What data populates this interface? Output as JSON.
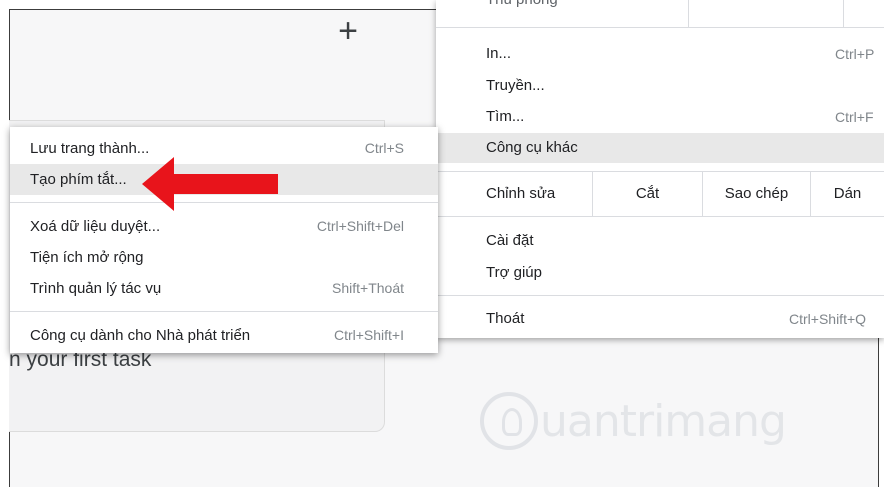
{
  "background": {
    "add_symbol": "+",
    "task_text": "n your first task",
    "watermark": "uantrimang"
  },
  "main_menu": {
    "top_partial_label": "Thu phóng",
    "items": [
      {
        "label": "In...",
        "shortcut": "Ctrl+P"
      },
      {
        "label": "Truyền...",
        "shortcut": ""
      },
      {
        "label": "Tìm...",
        "shortcut": "Ctrl+F"
      },
      {
        "label": "Công cụ khác",
        "shortcut": ""
      }
    ],
    "edit": {
      "label": "Chỉnh sửa",
      "cut": "Cắt",
      "copy": "Sao chép",
      "paste": "Dán"
    },
    "settings": "Cài đặt",
    "help": "Trợ giúp",
    "exit": {
      "label": "Thoát",
      "shortcut": "Ctrl+Shift+Q"
    }
  },
  "sub_menu": {
    "items": [
      {
        "label": "Lưu trang thành...",
        "shortcut": "Ctrl+S"
      },
      {
        "label": "Tạo phím tắt...",
        "shortcut": ""
      },
      {
        "label": "Xoá dữ liệu duyệt...",
        "shortcut": "Ctrl+Shift+Del"
      },
      {
        "label": "Tiện ích mở rộng",
        "shortcut": ""
      },
      {
        "label": "Trình quản lý tác vụ",
        "shortcut": "Shift+Thoát"
      },
      {
        "label": "Công cụ dành cho Nhà phát triển",
        "shortcut": "Ctrl+Shift+I"
      }
    ]
  },
  "colors": {
    "arrow": "#e8141b",
    "highlight": "#e8e8e8"
  }
}
